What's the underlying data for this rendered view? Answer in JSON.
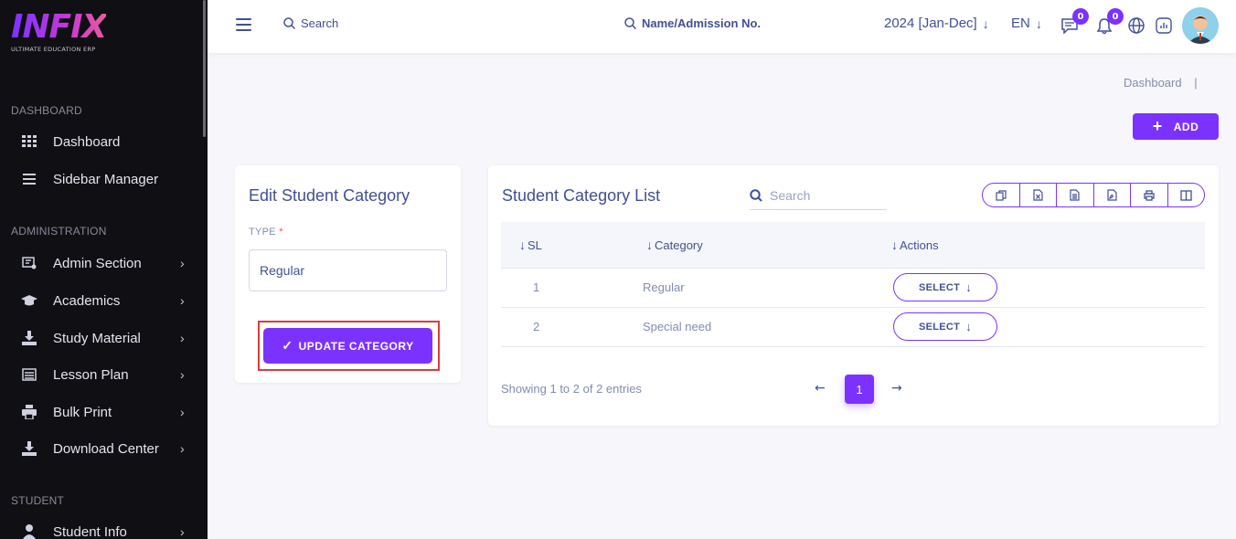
{
  "sidebar": {
    "logo": "INFIX",
    "logo_tagline": "ULTIMATE EDUCATION ERP",
    "sections": [
      {
        "label": "DASHBOARD"
      },
      {
        "label": "ADMINISTRATION"
      },
      {
        "label": "STUDENT"
      }
    ],
    "items": [
      {
        "label": "Dashboard",
        "icon": "grid-icon"
      },
      {
        "label": "Sidebar Manager",
        "icon": "list-icon"
      },
      {
        "label": "Admin Section",
        "icon": "admin-icon"
      },
      {
        "label": "Academics",
        "icon": "graduation-cap-icon"
      },
      {
        "label": "Study Material",
        "icon": "download-icon"
      },
      {
        "label": "Lesson Plan",
        "icon": "lesson-icon"
      },
      {
        "label": "Bulk Print",
        "icon": "printer-icon"
      },
      {
        "label": "Download Center",
        "icon": "download-icon"
      },
      {
        "label": "Student Info",
        "icon": "user-icon"
      }
    ]
  },
  "header": {
    "search_label": "Search",
    "name_search_label": "Name/Admission No.",
    "academic_year": "2024 [Jan-Dec]",
    "language": "EN",
    "chat_badge": "0",
    "notification_badge": "0"
  },
  "breadcrumb": {
    "text": "Dashboard",
    "separator": "|"
  },
  "add_button": {
    "label": "ADD"
  },
  "edit_form": {
    "title": "Edit Student Category",
    "type_label": "TYPE",
    "required_mark": "*",
    "type_value": "Regular",
    "submit_label": "UPDATE CATEGORY"
  },
  "list": {
    "title": "Student Category List",
    "search_placeholder": "Search",
    "columns": [
      "SL",
      "Category",
      "Actions"
    ],
    "rows": [
      {
        "sl": "1",
        "category": "Regular",
        "action": "SELECT"
      },
      {
        "sl": "2",
        "category": "Special need",
        "action": "SELECT"
      }
    ],
    "showing": "Showing 1 to 2 of 2 entries",
    "current_page": "1"
  },
  "colors": {
    "accent": "#7c32ff",
    "text": "#415094",
    "sidebar_bg": "#0f0f14",
    "highlight": "#e03a3a"
  }
}
